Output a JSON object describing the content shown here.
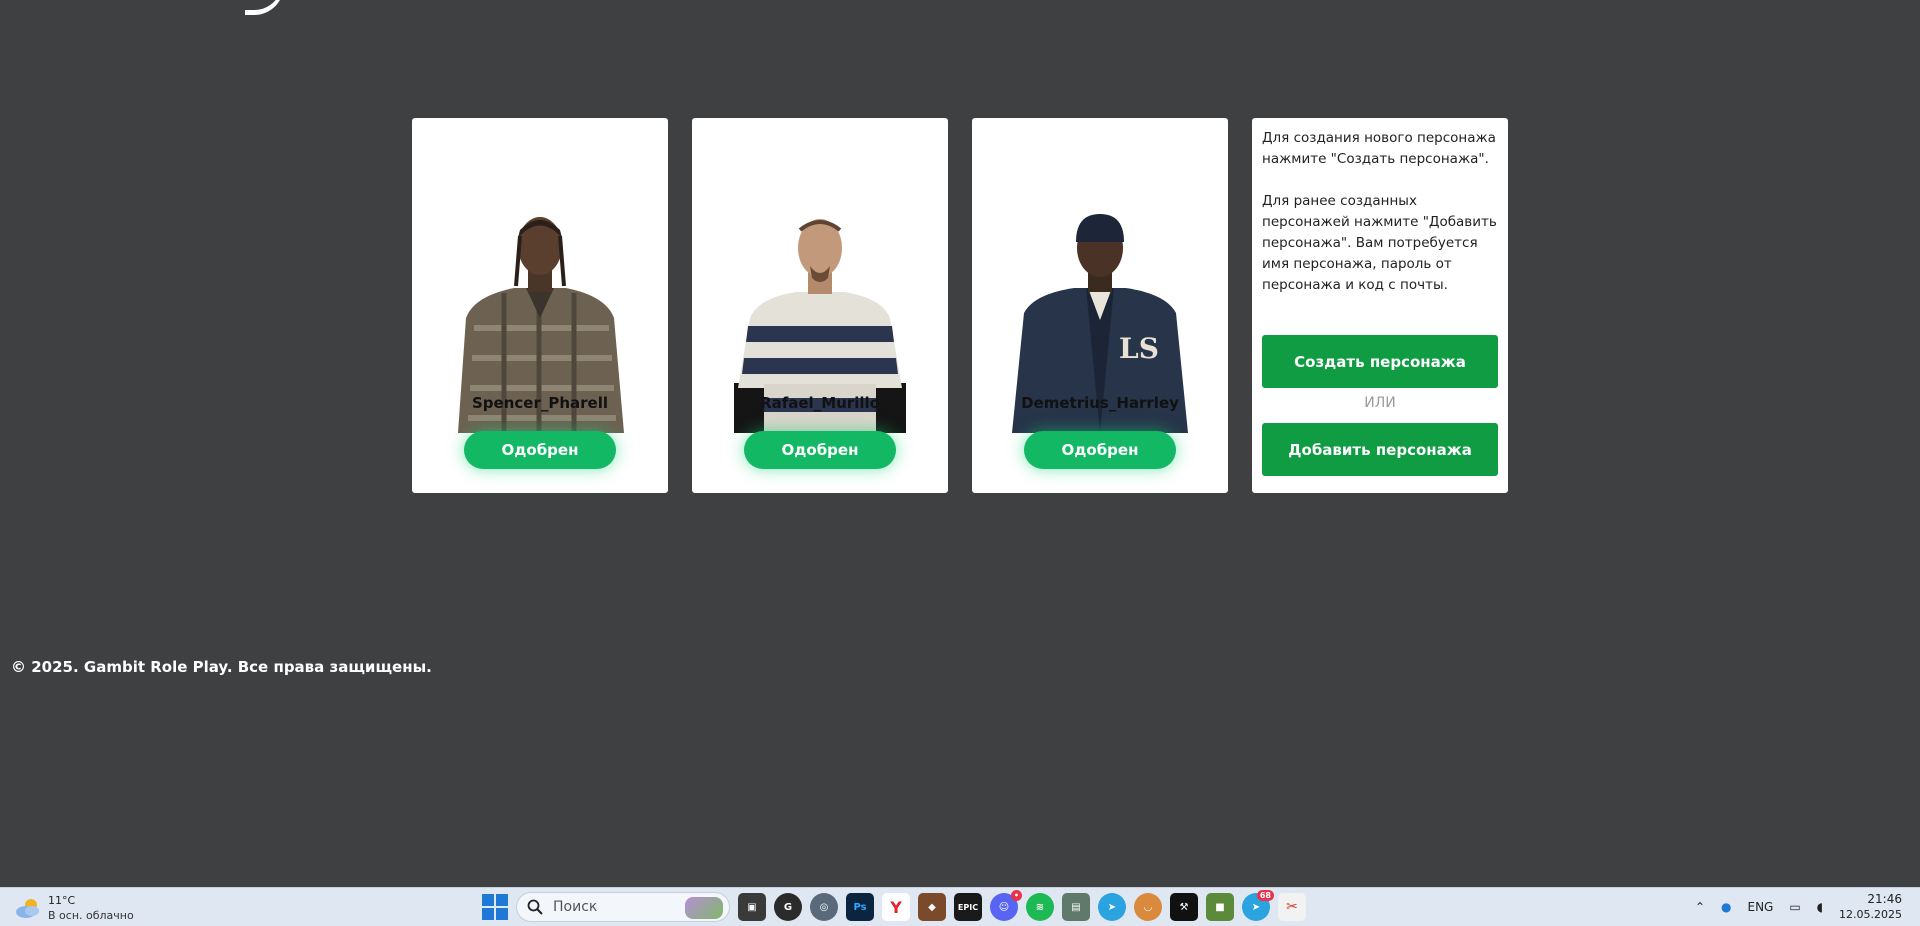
{
  "characters": [
    {
      "name": "Spencer_Pharell",
      "status": "Одобрен"
    },
    {
      "name": "Rafael_Murillo",
      "status": "Одобрен"
    },
    {
      "name": "Demetrius_Harrley",
      "status": "Одобрен"
    }
  ],
  "info": {
    "text1": "Для создания нового персонажа нажмите \"Создать персонажа\".",
    "text2": "Для ранее созданных персонажей нажмите \"Добавить персонажа\". Вам потребуется имя персонажа, пароль от персонажа и код с почты.",
    "create_button": "Создать персонажа",
    "or_label": "ИЛИ",
    "add_button": "Добавить персонажа"
  },
  "footer": {
    "text": "© 2025. Gambit Role Play. Все права защищены."
  },
  "taskbar": {
    "weather_temp": "11°C",
    "weather_desc": "В осн. облачно",
    "search_placeholder": "Поиск",
    "badge": "68",
    "language": "ENG",
    "time": "21:46",
    "date": "12.05.2025"
  },
  "colors": {
    "page_bg": "#3f4042",
    "status_green": "#13b864",
    "action_green": "#0f9c43"
  }
}
